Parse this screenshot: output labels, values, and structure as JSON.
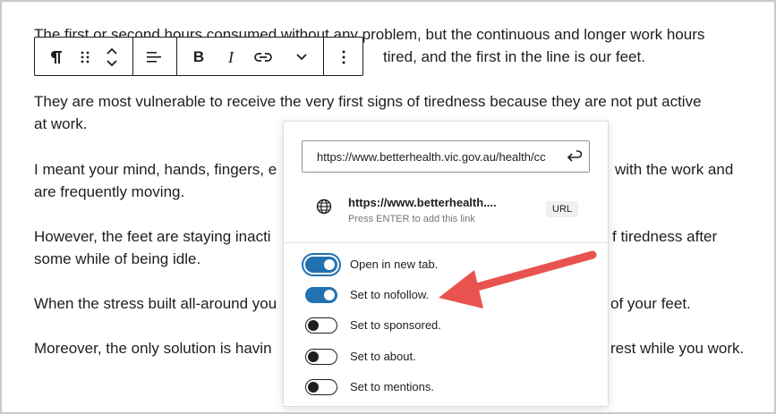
{
  "paragraphs": [
    "The first or second hours consumed without any problem, but the continuous and longer work hours",
    "tired, and the first in the line is our feet.",
    "They are most vulnerable to receive the very first signs of tiredness because they are not put active",
    "at work.",
    "I meant your mind, hands, fingers, e",
    "with the work and",
    "are frequently moving.",
    "However, the feet are staying inacti",
    "f tiredness after",
    "some while of being idle.",
    "When the stress built all-around you",
    "of your feet.",
    "Moreover, the only solution is havin",
    "rest while you work."
  ],
  "toolbar": {
    "paragraph_icon": "pilcrow-icon",
    "drag_icon": "drag-handle-icon",
    "move_icon": "move-up-down-icon",
    "align_icon": "align-left-icon",
    "bold_label": "B",
    "italic_label": "I",
    "link_icon": "link-icon",
    "more_icon": "chevron-down-icon",
    "options_icon": "more-vertical-icon"
  },
  "link_popover": {
    "url_value": "https://www.betterhealth.vic.gov.au/health/cc",
    "suggestion_title": "https://www.betterhealth....",
    "suggestion_hint": "Press ENTER to add this link",
    "suggestion_badge": "URL",
    "options": [
      {
        "label": "Open in new tab.",
        "checked": true
      },
      {
        "label": "Set to nofollow.",
        "checked": true
      },
      {
        "label": "Set to sponsored.",
        "checked": false
      },
      {
        "label": "Set to about.",
        "checked": false
      },
      {
        "label": "Set to mentions.",
        "checked": false
      }
    ]
  },
  "colors": {
    "accent": "#2271b1",
    "arrow": "#e8534f"
  }
}
